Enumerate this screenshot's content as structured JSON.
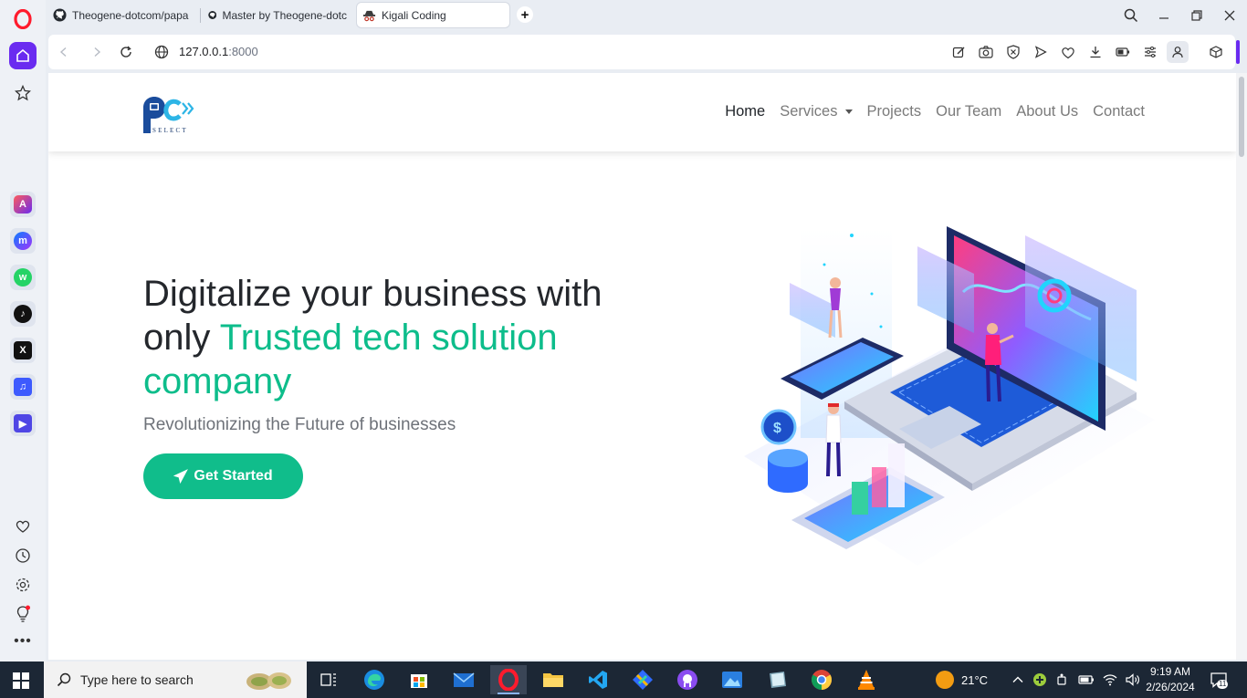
{
  "browser": {
    "tabs": [
      {
        "label": "Theogene-dotcom/papa",
        "icon": "github-icon"
      },
      {
        "label": "Master by Theogene-dotc",
        "icon": "github-icon"
      },
      {
        "label": "Kigali Coding",
        "icon": "spy-hat-icon",
        "active": true
      }
    ],
    "url_host": "127.0.0.1",
    "url_port": ":8000"
  },
  "site": {
    "logo_text": "SELECT",
    "nav": [
      {
        "label": "Home",
        "active": true
      },
      {
        "label": "Services",
        "dropdown": true
      },
      {
        "label": "Projects"
      },
      {
        "label": "Our Team"
      },
      {
        "label": "About Us"
      },
      {
        "label": "Contact"
      }
    ],
    "hero": {
      "title_part1": "Digitalize your business with only ",
      "title_highlight": "Trusted tech solution company",
      "subtitle": "Revolutionizing the Future of businesses",
      "cta_label": "Get Started"
    },
    "colors": {
      "accent": "#10bd8b",
      "text": "#24272c",
      "opera_purple": "#6a2bf0"
    }
  },
  "taskbar": {
    "search_placeholder": "Type here to search",
    "weather": "21°C",
    "time": "9:19 AM",
    "date": "2/26/2024",
    "notification_count": "11"
  }
}
